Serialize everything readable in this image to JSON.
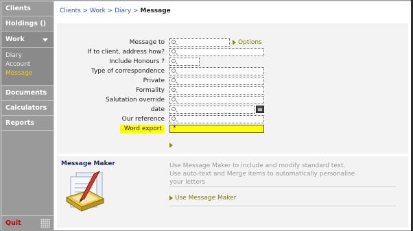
{
  "sidebar": {
    "items": [
      {
        "label": "Clients"
      },
      {
        "label": "Holdings ()"
      },
      {
        "label": "Work"
      },
      {
        "label": "Documents"
      },
      {
        "label": "Calculators"
      },
      {
        "label": "Reports"
      }
    ],
    "subnav": [
      "Diary",
      "Account",
      "Message"
    ],
    "quit_label": "Quit"
  },
  "breadcrumb": {
    "items": [
      "Clients",
      "Work",
      "Diary"
    ],
    "separator": ">",
    "current": "Message"
  },
  "form": {
    "options_label": "Options",
    "fields": [
      {
        "label": "Message to",
        "value": ""
      },
      {
        "label": "If to client, address how?",
        "value": ""
      },
      {
        "label": "Include Honours ?",
        "value": ""
      },
      {
        "label": "Type of correspondence",
        "value": ""
      },
      {
        "label": "Private",
        "value": ""
      },
      {
        "label": "Formality",
        "value": ""
      },
      {
        "label": "Salutation override",
        "value": ""
      },
      {
        "label": "date",
        "value": ""
      },
      {
        "label": "Our reference",
        "value": ""
      },
      {
        "label": "Word export",
        "value": "*"
      }
    ]
  },
  "message_maker": {
    "title": "Message Maker",
    "desc_line1": "Use Message Maker to include and modify standard text.",
    "desc_line2": "Use auto-text and Merge items to automatically personalise",
    "desc_line3": "your letters",
    "link_label": "Use Message Maker"
  },
  "colors": {
    "sidebar_bg": "#9a9a9a",
    "active_sub": "#f5d000",
    "quit": "#c00000",
    "highlight": "#ffff00",
    "link": "#7a7a00",
    "breadcrumb": "#3355aa"
  }
}
